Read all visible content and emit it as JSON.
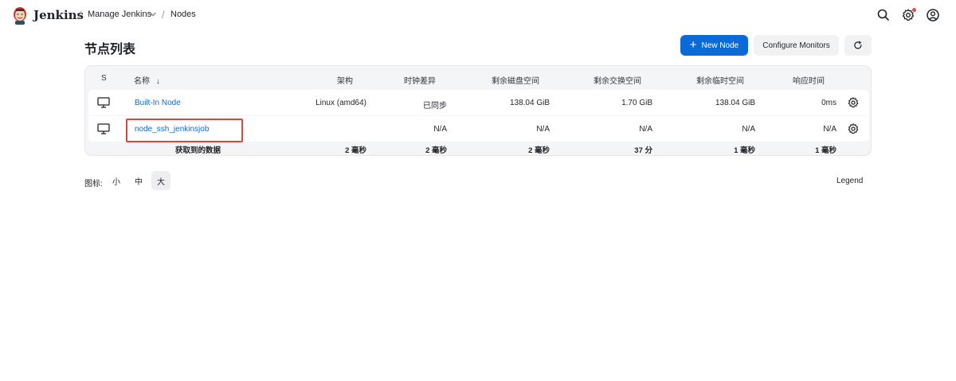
{
  "header": {
    "brand": "Jenkins",
    "breadcrumbs": [
      "Manage Jenkins",
      "Nodes"
    ],
    "icons": [
      "search-icon",
      "settings-icon",
      "user-icon"
    ],
    "notification_color": "#e5484d"
  },
  "page": {
    "title": "节点列表",
    "new_node_label": "New Node",
    "configure_monitors_label": "Configure Monitors",
    "accent_color": "#0b6bd6"
  },
  "table": {
    "headers": {
      "status": "S",
      "name": "名称",
      "arch": "架构",
      "clock": "时钟差异",
      "disk": "剩余磁盘空间",
      "swap": "剩余交换空间",
      "temp": "剩余临时空间",
      "response": "响应时间"
    },
    "rows": [
      {
        "name": "Built-In Node",
        "arch": "Linux (amd64)",
        "clock": "已同步",
        "disk": "138.04 GiB",
        "swap": "1.70 GiB",
        "temp": "138.04 GiB",
        "response": "0ms"
      },
      {
        "name": "node_ssh_jenkinsjob",
        "arch": "",
        "clock": "N/A",
        "disk": "N/A",
        "swap": "N/A",
        "temp": "N/A",
        "response": "N/A"
      }
    ],
    "footer": {
      "label": "获取到的数据",
      "arch": "2 毫秒",
      "clock": "2 毫秒",
      "disk": "2 毫秒",
      "swap": "37 分",
      "temp": "1 毫秒",
      "response": "1 毫秒"
    }
  },
  "icon_size": {
    "label": "图标:",
    "options": [
      "小",
      "中",
      "大"
    ],
    "selected": "大"
  },
  "legend_label": "Legend"
}
